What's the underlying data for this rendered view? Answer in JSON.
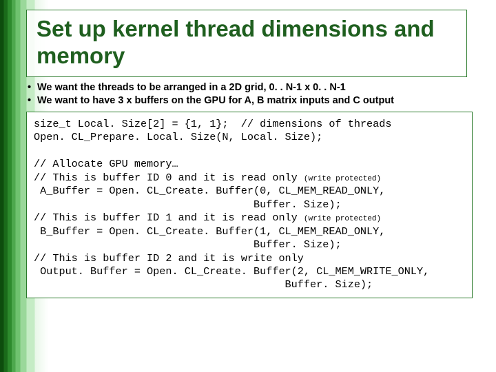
{
  "title": "Set up kernel thread dimensions and memory",
  "bullets": [
    "We want the threads to be arranged in a 2D grid, 0. . N-1  x 0. . N-1",
    "We want to have 3 x buffers on the GPU for A, B matrix inputs and C output"
  ],
  "code": {
    "l1": "size_t Local. Size[2] = {1, 1};  // dimensions of threads",
    "l2": "Open. CL_Prepare. Local. Size(N, Local. Size);",
    "l3": "",
    "l4": "// Allocate GPU memory…",
    "l5a": "// This is buffer ID 0 and it is read only ",
    "l5b": "(write protected)",
    "l6": " A_Buffer = Open. CL_Create. Buffer(0, CL_MEM_READ_ONLY,",
    "l7": "                                   Buffer. Size);",
    "l8a": "// This is buffer ID 1 and it is read only ",
    "l8b": "(write protected)",
    "l9": " B_Buffer = Open. CL_Create. Buffer(1, CL_MEM_READ_ONLY,",
    "l10": "                                   Buffer. Size);",
    "l11": "// This is buffer ID 2 and it is write only",
    "l12": " Output. Buffer = Open. CL_Create. Buffer(2, CL_MEM_WRITE_ONLY,",
    "l13": "                                        Buffer. Size);"
  }
}
